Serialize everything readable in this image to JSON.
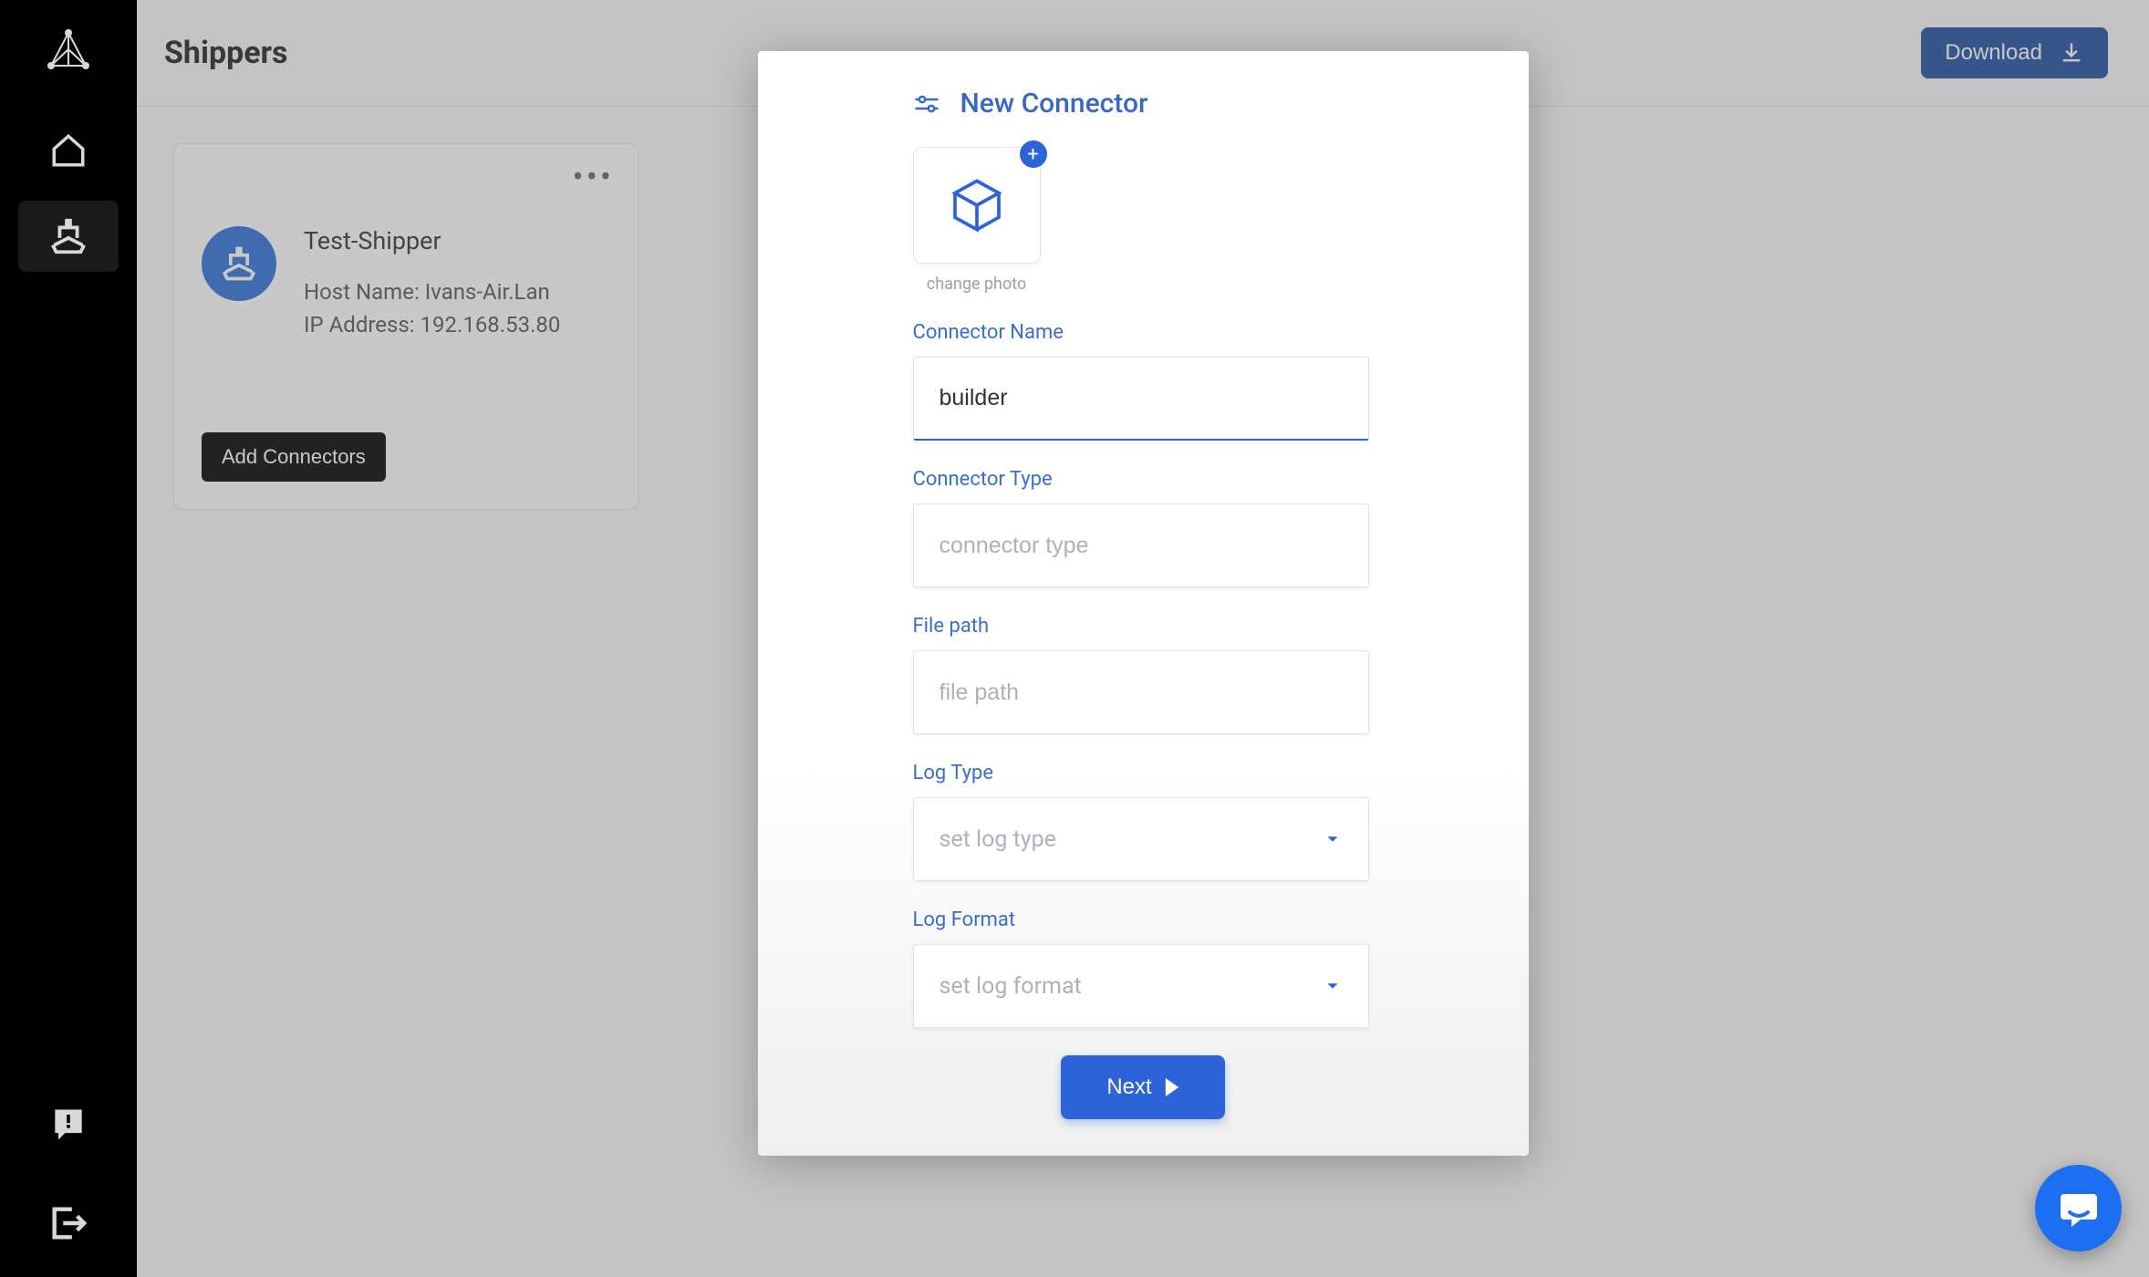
{
  "sidebar": {
    "icons": [
      "logo",
      "home",
      "ship",
      "feedback",
      "logout"
    ]
  },
  "header": {
    "title": "Shippers",
    "download_label": "Download"
  },
  "shipper_card": {
    "name": "Test-Shipper",
    "host_label": "Host Name: ",
    "host_value": "Ivans-Air.Lan",
    "ip_label": "IP Address: ",
    "ip_value": "192.168.53.80",
    "button_label": "Add Connectors"
  },
  "modal": {
    "title": "New Connector",
    "change_photo": "change photo",
    "fields": {
      "name": {
        "label": "Connector Name",
        "value": "builder",
        "placeholder": ""
      },
      "type": {
        "label": "Connector Type",
        "value": "",
        "placeholder": "connector type"
      },
      "path": {
        "label": "File path",
        "value": "",
        "placeholder": "file path"
      },
      "log_type": {
        "label": "Log Type",
        "placeholder": "set log type"
      },
      "log_format": {
        "label": "Log Format",
        "placeholder": "set log format"
      }
    },
    "next_label": "Next"
  }
}
